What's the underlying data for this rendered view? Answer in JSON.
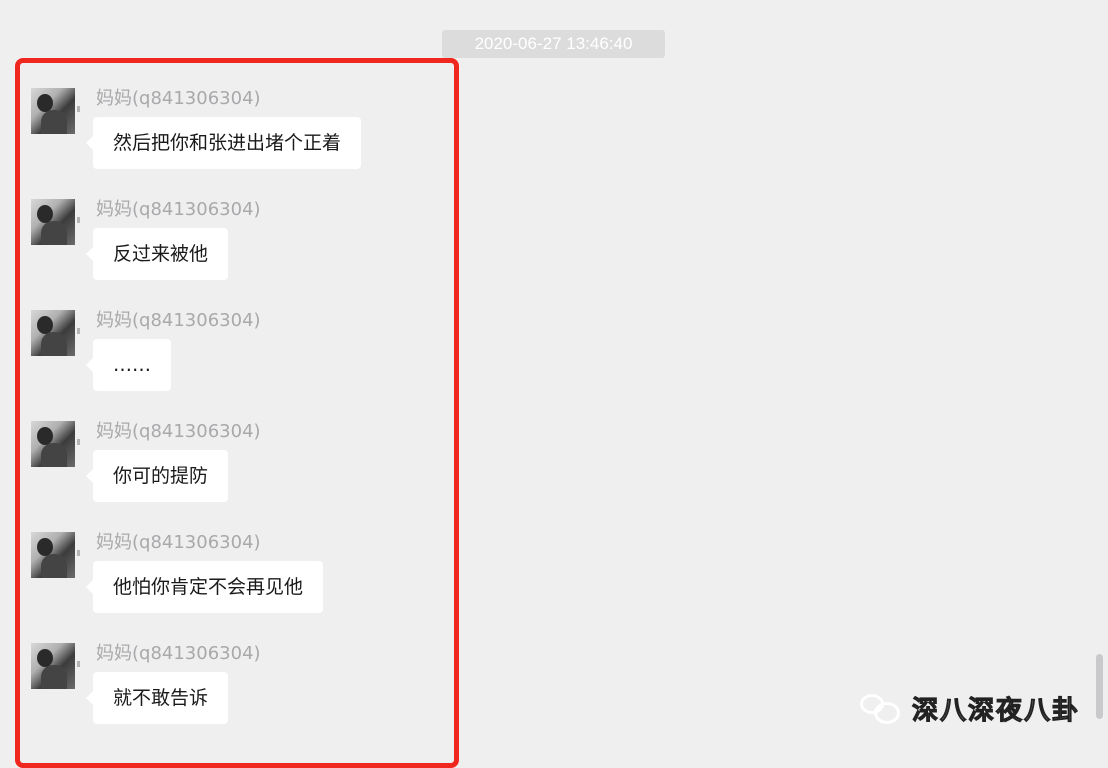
{
  "timestamp": "2020-06-27 13:46:40",
  "messages": [
    {
      "sender": "妈妈(q841306304)",
      "text": "然后把你和张进出堵个正着"
    },
    {
      "sender": "妈妈(q841306304)",
      "text": "反过来被他"
    },
    {
      "sender": "妈妈(q841306304)",
      "text": "……"
    },
    {
      "sender": "妈妈(q841306304)",
      "text": "你可的提防"
    },
    {
      "sender": "妈妈(q841306304)",
      "text": "他怕你肯定不会再见他"
    },
    {
      "sender": "妈妈(q841306304)",
      "text": "就不敢告诉"
    }
  ],
  "watermark": {
    "text": "深八深夜八卦",
    "icon": "wechat-icon"
  },
  "colors": {
    "background": "#efeff0",
    "highlight_border": "#f0271e",
    "bubble": "#ffffff",
    "sender_text": "#a9a9ab"
  }
}
